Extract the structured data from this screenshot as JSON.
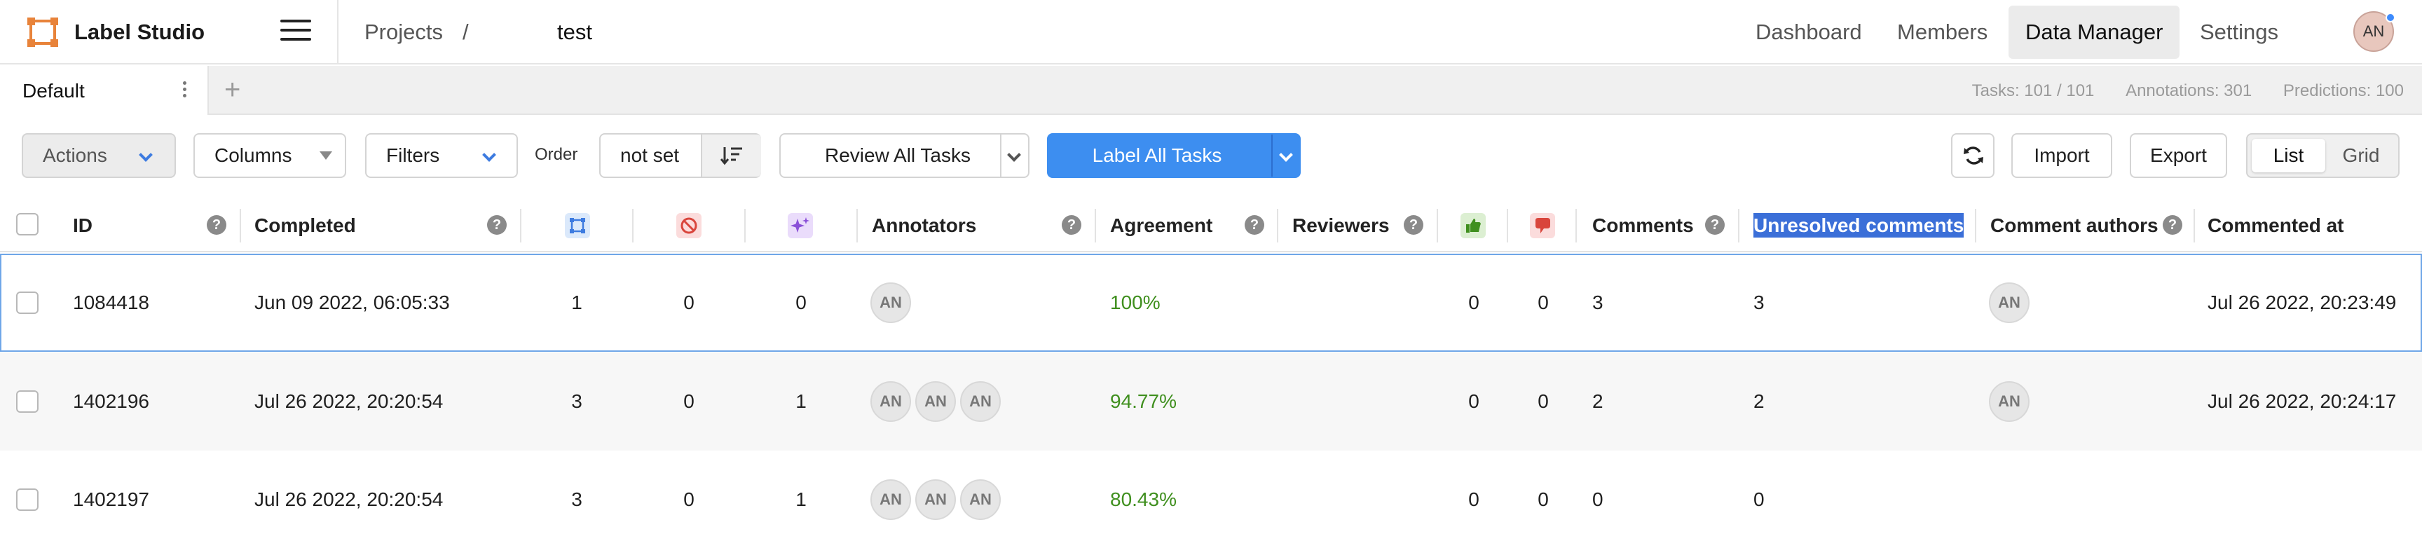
{
  "app": {
    "name": "Label Studio",
    "logo_icon": "label-studio-logo-icon",
    "accent": "#3d8ef0"
  },
  "breadcrumb": {
    "projects": "Projects",
    "separator": "/",
    "current": "test"
  },
  "nav": {
    "dashboard": "Dashboard",
    "members": "Members",
    "data_manager": "Data Manager",
    "settings": "Settings",
    "active": "Data Manager"
  },
  "user": {
    "initials": "AN"
  },
  "tabs": {
    "items": [
      {
        "label": "Default"
      }
    ],
    "add_label": "+"
  },
  "stats": {
    "tasks": "Tasks: 101 / 101",
    "annotations": "Annotations: 301",
    "predictions": "Predictions: 100"
  },
  "toolbar": {
    "actions": "Actions",
    "columns": "Columns",
    "filters": "Filters",
    "order_label": "Order",
    "order_value": "not set",
    "review_all": "Review All Tasks",
    "label_all": "Label All Tasks",
    "import": "Import",
    "export": "Export",
    "view_list": "List",
    "view_grid": "Grid",
    "view_selected": "List"
  },
  "table": {
    "headers": {
      "id": "ID",
      "completed": "Completed",
      "annotators": "Annotators",
      "agreement": "Agreement",
      "reviewers": "Reviewers",
      "comments": "Comments",
      "unresolved": "Unresolved comments",
      "comment_authors": "Comment authors",
      "commented_at": "Commented at",
      "icons": [
        "annotations-count-icon",
        "cancelled-icon",
        "predictions-icon",
        "thumbs-up-icon",
        "thumbs-down-icon"
      ]
    },
    "rows": [
      {
        "id": "1084418",
        "completed": "Jun 09 2022, 06:05:33",
        "annotations": "1",
        "cancelled": "0",
        "predictions": "0",
        "annotators": [
          "AN"
        ],
        "agreement": "100%",
        "accepted": "0",
        "rejected": "0",
        "comments": "3",
        "unresolved": "3",
        "comment_authors": [
          "AN"
        ],
        "commented_at": "Jul 26 2022, 20:23:49"
      },
      {
        "id": "1402196",
        "completed": "Jul 26 2022, 20:20:54",
        "annotations": "3",
        "cancelled": "0",
        "predictions": "1",
        "annotators": [
          "AN",
          "AN",
          "AN"
        ],
        "agreement": "94.77%",
        "accepted": "0",
        "rejected": "0",
        "comments": "2",
        "unresolved": "2",
        "comment_authors": [
          "AN"
        ],
        "commented_at": "Jul 26 2022, 20:24:17"
      },
      {
        "id": "1402197",
        "completed": "Jul 26 2022, 20:20:54",
        "annotations": "3",
        "cancelled": "0",
        "predictions": "1",
        "annotators": [
          "AN",
          "AN",
          "AN"
        ],
        "agreement": "80.43%",
        "accepted": "0",
        "rejected": "0",
        "comments": "0",
        "unresolved": "0",
        "comment_authors": [],
        "commented_at": ""
      }
    ]
  }
}
